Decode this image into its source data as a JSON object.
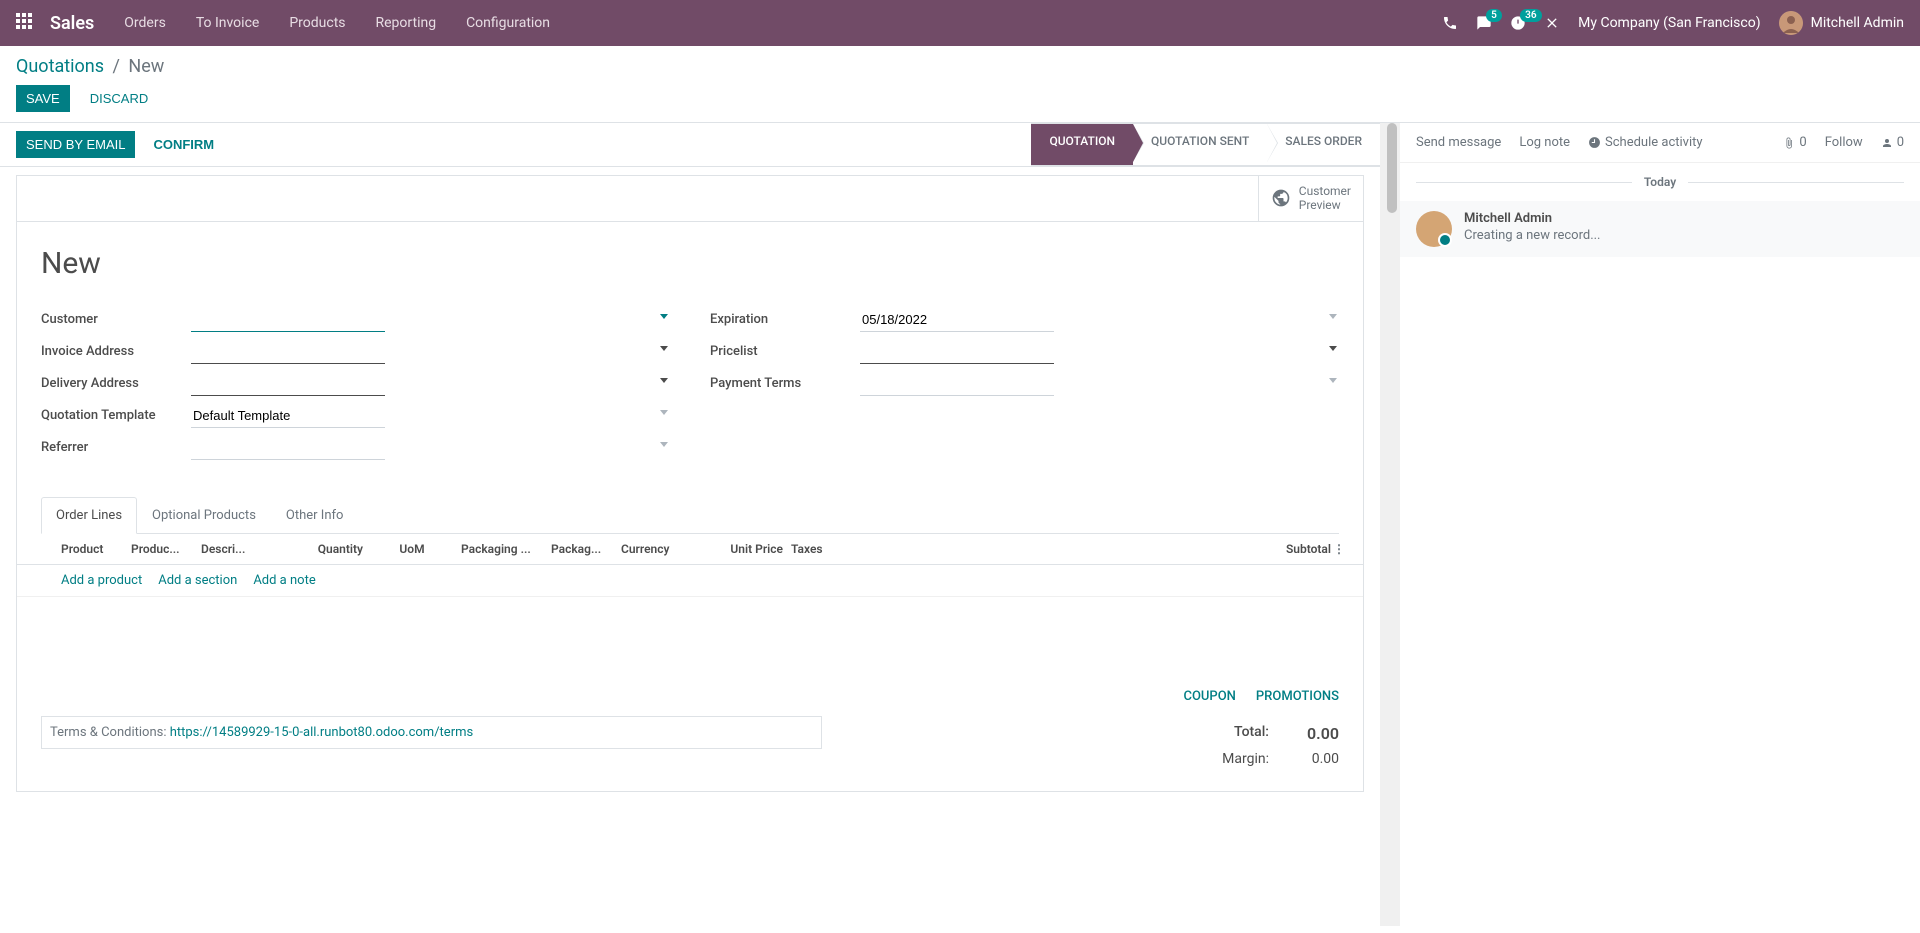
{
  "nav": {
    "brand": "Sales",
    "menu": [
      "Orders",
      "To Invoice",
      "Products",
      "Reporting",
      "Configuration"
    ],
    "badges": {
      "chat": "5",
      "activity": "36"
    },
    "company": "My Company (San Francisco)",
    "user": "Mitchell Admin"
  },
  "breadcrumb": {
    "main": "Quotations",
    "current": "New"
  },
  "buttons": {
    "save": "Save",
    "discard": "Discard",
    "send": "Send by Email",
    "confirm": "Confirm"
  },
  "status": {
    "quotation": "Quotation",
    "sent": "Quotation Sent",
    "order": "Sales Order"
  },
  "preview": {
    "l1": "Customer",
    "l2": "Preview"
  },
  "title": "New",
  "fields": {
    "customer": "Customer",
    "invoice_addr": "Invoice Address",
    "delivery_addr": "Delivery Address",
    "template": "Quotation Template",
    "template_val": "Default Template",
    "referrer": "Referrer",
    "expiration": "Expiration",
    "expiration_val": "05/18/2022",
    "pricelist": "Pricelist",
    "payment_terms": "Payment Terms"
  },
  "tabs": {
    "lines": "Order Lines",
    "optional": "Optional Products",
    "other": "Other Info"
  },
  "cols": {
    "product": "Product",
    "producttmpl": "Produc...",
    "desc": "Descri...",
    "qty": "Quantity",
    "uom": "UoM",
    "pack1": "Packaging ...",
    "pack2": "Packag...",
    "currency": "Currency",
    "unit_price": "Unit Price",
    "taxes": "Taxes",
    "subtotal": "Subtotal"
  },
  "line_actions": {
    "product": "Add a product",
    "section": "Add a section",
    "note": "Add a note"
  },
  "footer_links": {
    "coupon": "Coupon",
    "promo": "Promotions"
  },
  "totals": {
    "total_label": "Total:",
    "total_val": "0.00",
    "margin_label": "Margin:",
    "margin_val": "0.00"
  },
  "terms": {
    "prefix": "Terms & Conditions: ",
    "link": "https://14589929-15-0-all.runbot80.odoo.com/terms"
  },
  "chatter": {
    "send": "Send message",
    "log": "Log note",
    "schedule": "Schedule activity",
    "attach": "0",
    "follow": "Follow",
    "followers": "0",
    "today": "Today",
    "msg": {
      "author": "Mitchell Admin",
      "body": "Creating a new record..."
    }
  }
}
